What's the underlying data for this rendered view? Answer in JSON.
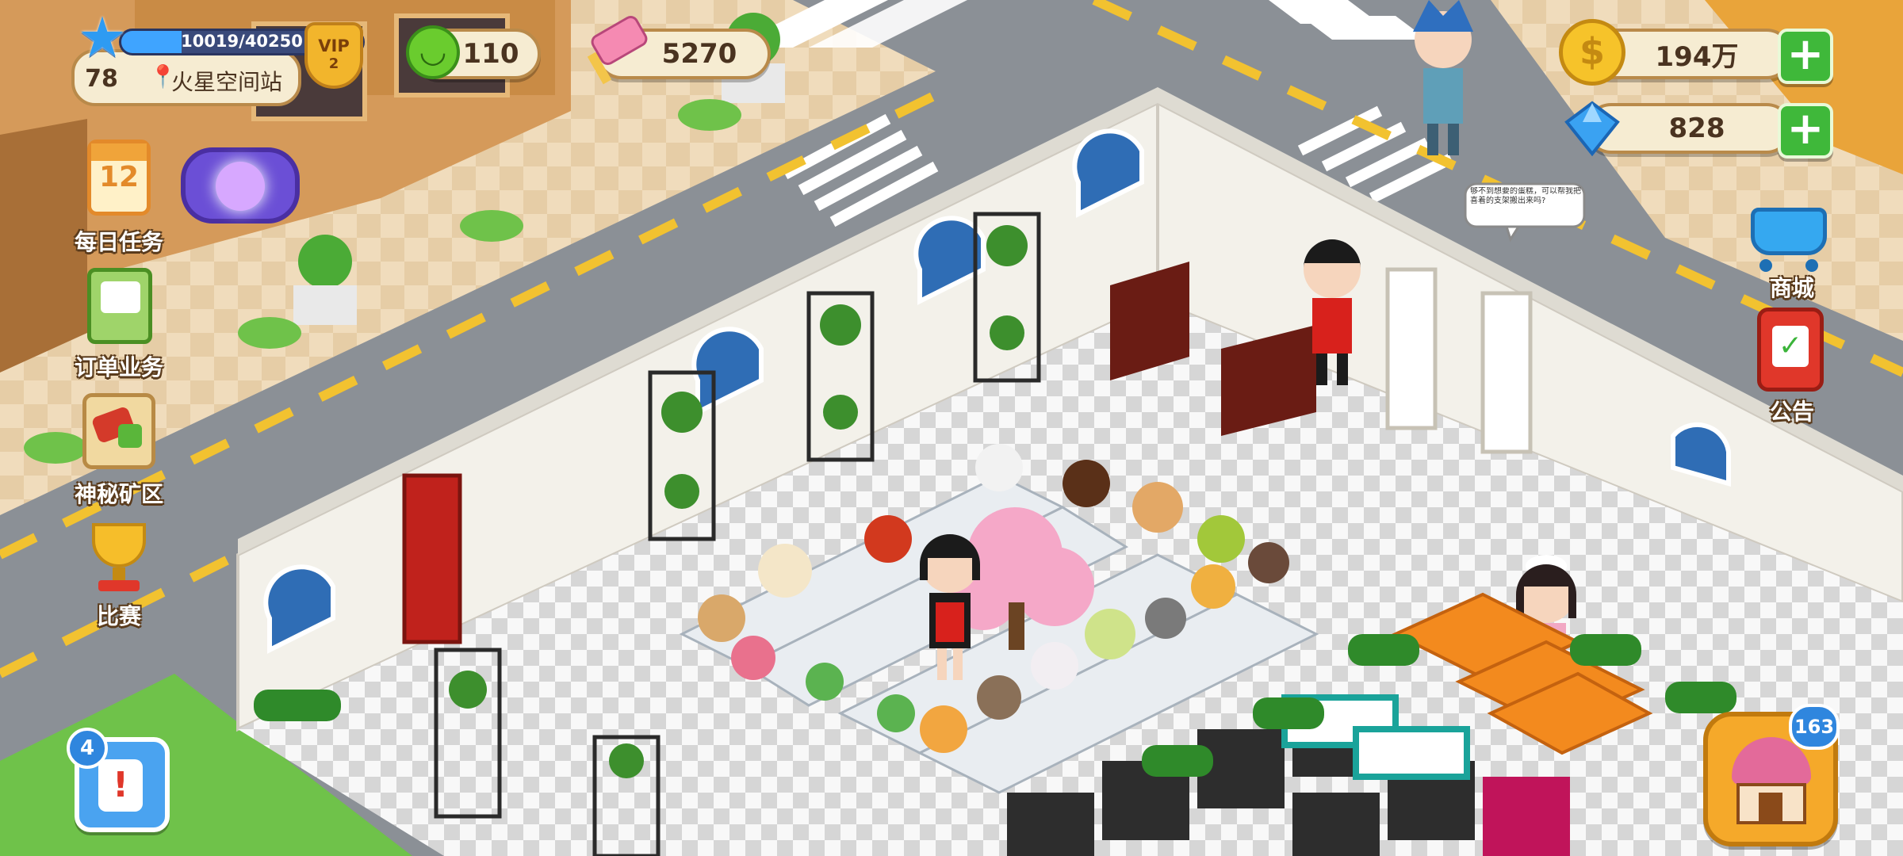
{
  "player": {
    "xp_text": "10019/40250",
    "xp_progress": 0.249,
    "level": "78",
    "location": "火星空间站",
    "vip_label": "VIP",
    "vip_level": "2"
  },
  "resources": {
    "happiness": "110",
    "hammer": "5270",
    "gold": "194万",
    "diamonds": "828"
  },
  "left_menu": {
    "daily_tasks": {
      "label": "每日任务",
      "calendar_day": "12"
    },
    "orders": {
      "label": "订单业务"
    },
    "mine": {
      "label": "神秘矿区"
    },
    "contest": {
      "label": "比赛"
    },
    "notes_badge": "4"
  },
  "right_menu": {
    "shop": {
      "label": "商城"
    },
    "notice": {
      "label": "公告"
    },
    "bakery_badge": "163"
  },
  "scene": {
    "customer_bubble": "够不到想要的蛋糕，可以帮我把喜着的支架搬出来吗?"
  },
  "colors": {
    "road": "#8b9096",
    "grass": "#6fc24a",
    "wall": "#f3f1ea",
    "floor_dark": "#d6d6d6",
    "floor_light": "#f8f8f8",
    "plus_green": "#3fb83a",
    "pill_bg": "#f6ecd2"
  }
}
